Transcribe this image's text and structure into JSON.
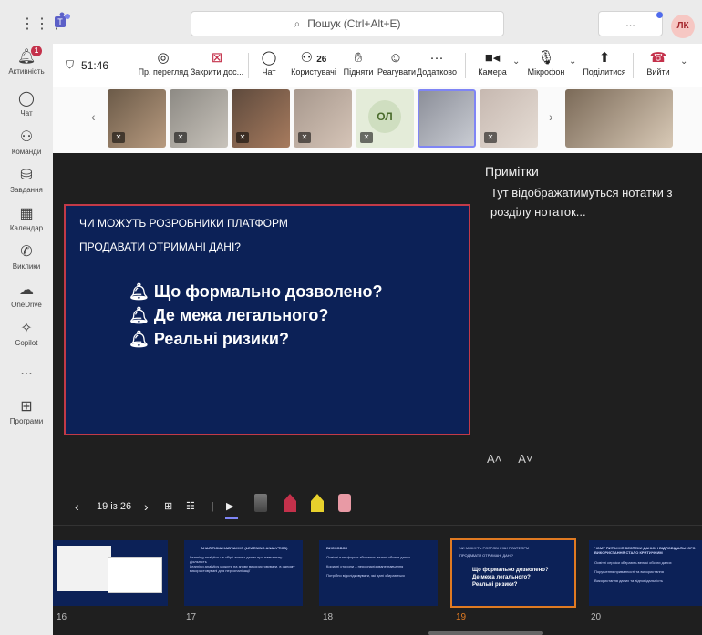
{
  "topbar": {
    "search_placeholder": "Пошук (Ctrl+Alt+E)",
    "more": "...",
    "avatar": "ЛК"
  },
  "rail": {
    "items": [
      {
        "label": "Активність",
        "icon": "bell-icon",
        "badge": "1"
      },
      {
        "label": "Чат",
        "icon": "chat-icon"
      },
      {
        "label": "Команди",
        "icon": "teams-icon"
      },
      {
        "label": "Завдання",
        "icon": "tasks-icon"
      },
      {
        "label": "Календар",
        "icon": "calendar-icon"
      },
      {
        "label": "Виклики",
        "icon": "phone-icon"
      },
      {
        "label": "OneDrive",
        "icon": "cloud-icon"
      },
      {
        "label": "Copilot",
        "icon": "copilot-icon"
      },
      {
        "label": "...",
        "icon": "more-icon"
      },
      {
        "label": "Програми",
        "icon": "apps-icon"
      }
    ]
  },
  "controls": {
    "timer": "51:46",
    "buttons": [
      {
        "label": "Пр. перегляд"
      },
      {
        "label": "Закрити дос..."
      },
      {
        "label": "Чат"
      },
      {
        "label": "Користувачі",
        "count": "26"
      },
      {
        "label": "Підняти"
      },
      {
        "label": "Реагувати"
      },
      {
        "label": "Додатково"
      },
      {
        "label": "Камера"
      },
      {
        "label": "Мікрофон"
      },
      {
        "label": "Поділитися"
      },
      {
        "label": "Вийти"
      }
    ]
  },
  "participants": {
    "initials_tile": "ОЛ"
  },
  "slide": {
    "line1": "ЧИ МОЖУТЬ РОЗРОБНИКИ ПЛАТФОРМ",
    "line2": "ПРОДАВАТИ ОТРИМАНІ ДАНІ?",
    "bullets": [
      "Що формально дозволено?",
      "Де межа легального?",
      "Реальні ризики?"
    ]
  },
  "notes": {
    "title": "Примітки",
    "text": "Тут відображатимуться нотатки з розділу нотаток..."
  },
  "font_controls": {
    "increase": "A˄",
    "decrease": "A˅"
  },
  "navbar": {
    "page": "19 із 26"
  },
  "thumbnails": [
    {
      "num": "16",
      "title": "",
      "lines": []
    },
    {
      "num": "17",
      "title": "АНАЛІТИКА НАВЧАННЯ (LEARNING ANALYTICS)",
      "lines": [
        "Learning analytics це збір і аналіз даних про навчальну діяльність",
        "Learning analytics можуть на знову використовувати, в одному використовувані для персоналізації"
      ]
    },
    {
      "num": "18",
      "title": "ВИСНОВОК",
      "lines": [
        "Освітні платформи збирають великі обсяги даних",
        "Корисні сторони – персоналізоване навчання",
        "Потрібно відслідковувати, які дані збираються"
      ]
    },
    {
      "num": "19",
      "title": "ЧИ МОЖУТЬ РОЗРОБНИКИ ПЛАТФОРМ",
      "lines": [
        "ПРОДАВАТИ ОТРИМАНІ ДАНІ?",
        "Що формально дозволено?",
        "Де межа легального?",
        "Реальні ризики?"
      ]
    },
    {
      "num": "20",
      "title": "ЧОМУ ПИТАННЯ БЕЗПЕКИ ДАНИХ І ВІДПОВІДАЛЬНОГО ВИКОРИСТАННЯ СТАЛО КРИТИЧНИМ",
      "lines": [
        "Освітні сервіси збирають великі обсяги даних",
        "Порушення приватності та використання",
        "Використання даних та відповідальність"
      ]
    }
  ]
}
